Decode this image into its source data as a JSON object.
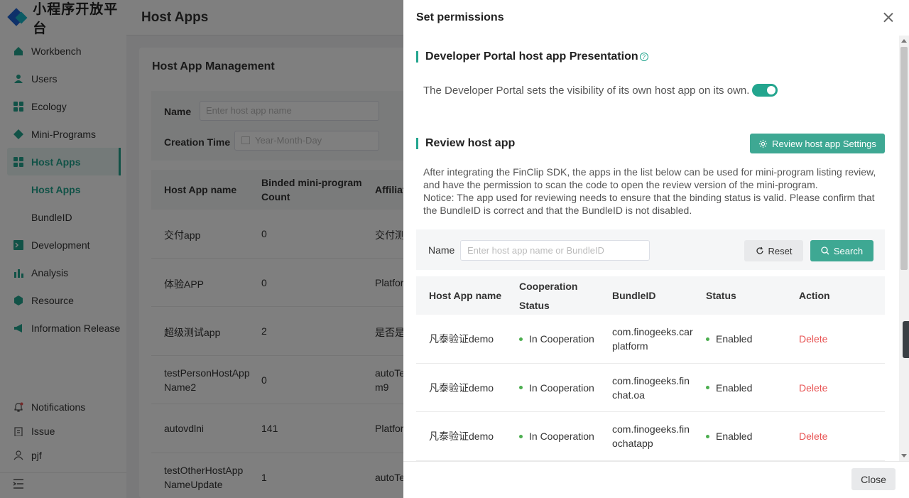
{
  "brand": {
    "name": "小程序开放平台",
    "colors": {
      "accent": "#23a58e",
      "logo_primary": "#1c62d4",
      "logo_secondary": "#18b6c8",
      "danger": "#e85454"
    }
  },
  "sidebar": {
    "items": [
      {
        "label": "Workbench",
        "icon": "home-icon"
      },
      {
        "label": "Users",
        "icon": "user-icon"
      },
      {
        "label": "Ecology",
        "icon": "grid-icon"
      },
      {
        "label": "Mini-Programs",
        "icon": "diamond-icon"
      },
      {
        "label": "Host Apps",
        "icon": "apps-icon"
      },
      {
        "label": "Host Apps"
      },
      {
        "label": "BundleID"
      },
      {
        "label": "Development",
        "icon": "terminal-icon"
      },
      {
        "label": "Analysis",
        "icon": "bar-chart-icon"
      },
      {
        "label": "Resource",
        "icon": "cube-icon"
      },
      {
        "label": "Information Release",
        "icon": "megaphone-icon"
      }
    ],
    "bottom": [
      {
        "label": "Notifications",
        "icon": "bell-icon"
      },
      {
        "label": "Issue",
        "icon": "clipboard-icon"
      },
      {
        "label": "pjf",
        "icon": "person-icon"
      }
    ]
  },
  "page": {
    "title": "Host Apps",
    "card_title": "Host App Management",
    "filter": {
      "name_label": "Name",
      "name_placeholder": "Enter host app name",
      "time_label": "Creation Time",
      "time_placeholder": "Year-Month-Day"
    },
    "table": {
      "headers": [
        "Host App name",
        "Binded mini-program",
        "Count",
        "Affiliat"
      ],
      "rows": [
        {
          "name": "交付app",
          "count": "0",
          "aff": "交付测"
        },
        {
          "name": "体验APP",
          "count": "0",
          "aff": "Platfor"
        },
        {
          "name": "超级测试app",
          "count": "2",
          "aff": "是否是"
        },
        {
          "name": "testPersonHostApp",
          "name2": "Name2",
          "count": "0",
          "aff": "autoTe",
          "aff2": "m9"
        },
        {
          "name": "autovdlni",
          "count": "141",
          "aff": "Platfor"
        },
        {
          "name": "testOtherHostApp",
          "name2": "NameUpdate",
          "count": "1",
          "aff": "autoTe"
        }
      ]
    }
  },
  "drawer": {
    "title": "Set permissions",
    "presentation": {
      "title": "Developer Portal host app Presentation",
      "help": "?",
      "description": "The Developer Portal sets the visibility of its own host app on its own.",
      "toggle_on": true
    },
    "review": {
      "title": "Review host app",
      "settings_button": "Review host app Settings",
      "paragraph": "After integrating the FinClip SDK, the apps in the list below can be used for mini-program listing review, and have the permission to scan the code to open the review version of the mini-program.",
      "notice": "Notice: The app used for reviewing needs to ensure that the binding status is valid. Please confirm that the BundleID is correct and that the BundleID is not disabled.",
      "search": {
        "label": "Name",
        "placeholder": "Enter host app name or BundleID",
        "reset": "Reset",
        "search": "Search"
      },
      "table": {
        "headers": {
          "name": "Host App name",
          "coop1": "Cooperation",
          "coop2": "Status",
          "bundle": "BundleID",
          "status": "Status",
          "action": "Action"
        },
        "rows": [
          {
            "name": "凡泰验证demo",
            "coop": "In Cooperation",
            "bundle1": "com.finogeeks.car",
            "bundle2": "platform",
            "status": "Enabled",
            "action": "Delete"
          },
          {
            "name": "凡泰验证demo",
            "coop": "In Cooperation",
            "bundle1": "com.finogeeks.fin",
            "bundle2": "chat.oa",
            "status": "Enabled",
            "action": "Delete"
          },
          {
            "name": "凡泰验证demo",
            "coop": "In Cooperation",
            "bundle1": "com.finogeeks.fin",
            "bundle2": "ochatapp",
            "status": "Enabled",
            "action": "Delete"
          }
        ]
      }
    },
    "close_button": "Close"
  }
}
